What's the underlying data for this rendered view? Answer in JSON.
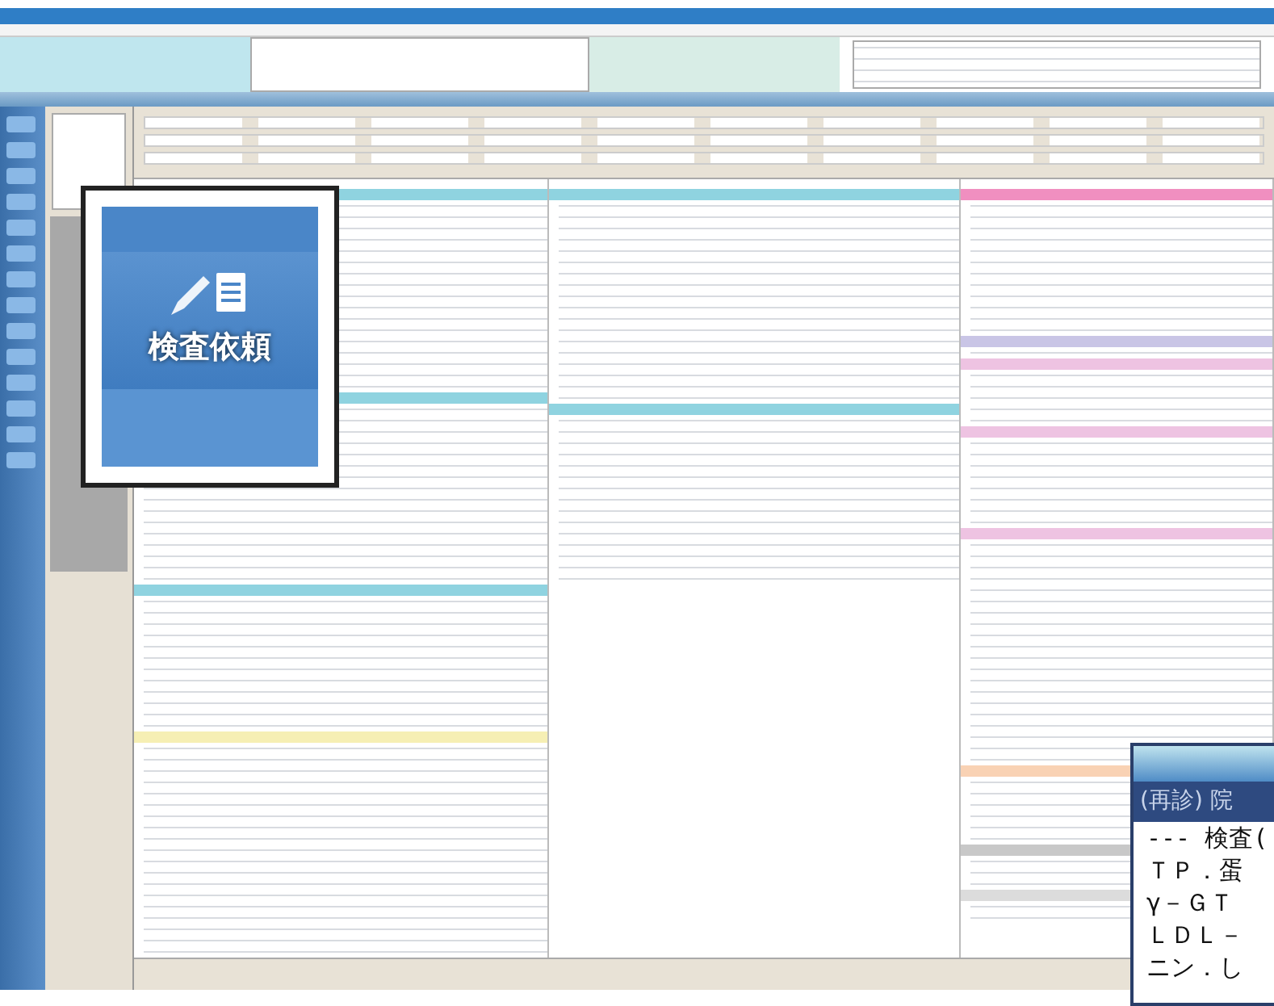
{
  "callout": {
    "button_label": "検査依頼"
  },
  "columns": [
    {
      "sections": [
        {
          "color": "#8fd3e0"
        },
        {
          "color": "#8fd3e0"
        },
        {
          "color": "#8fd3e0"
        },
        {
          "color": "#f6efb4"
        }
      ]
    },
    {
      "sections": [
        {
          "color": "#8fd3e0"
        },
        {
          "color": "#8fd3e0"
        }
      ]
    },
    {
      "sections": [
        {
          "color": "#f08fc0"
        },
        {
          "color": "#c9c5e6"
        },
        {
          "color": "#eec3e2"
        },
        {
          "color": "#eec3e2"
        },
        {
          "color": "#eec3e2"
        },
        {
          "color": "#f9d2b4"
        },
        {
          "color": "#c8c8c8"
        },
        {
          "color": "#dcdcdc"
        }
      ]
    }
  ],
  "inset": {
    "header": "(再診) 院",
    "lines": [
      "--- 検査(",
      "ＴＰ．蛋",
      "γ－ＧＴ",
      "ＬＤＬ－",
      "ニン．し"
    ]
  }
}
